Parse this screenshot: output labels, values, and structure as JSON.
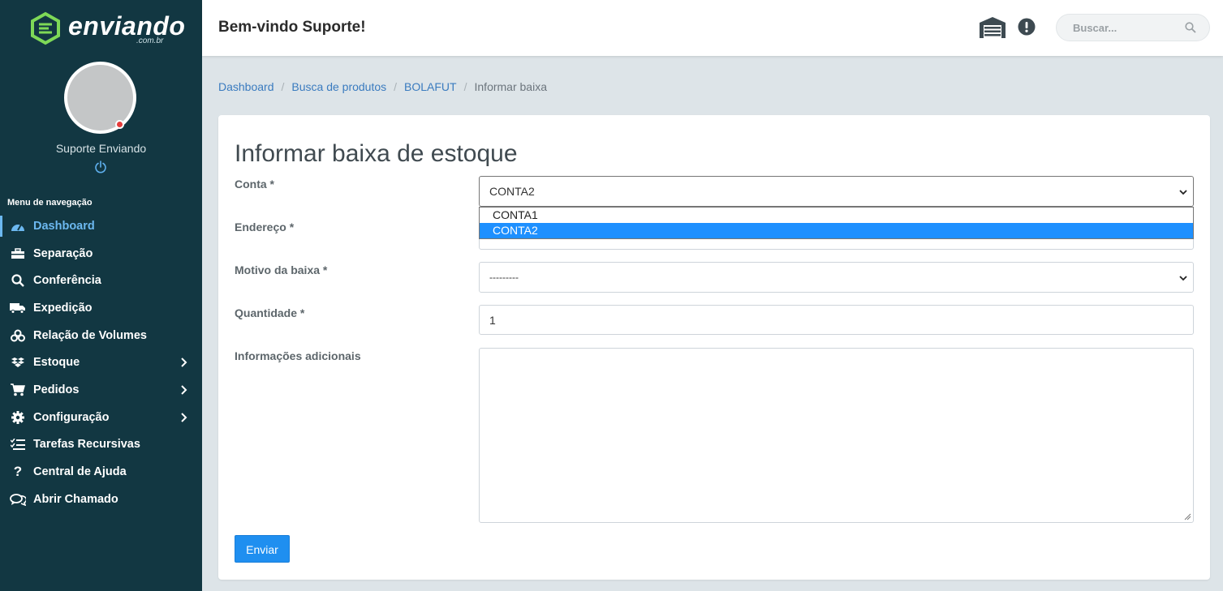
{
  "brand": {
    "name": "enviando",
    "domain": ".com.br"
  },
  "user": {
    "name": "Suporte Enviando"
  },
  "nav": {
    "title": "Menu de navegação",
    "items": [
      {
        "label": "Dashboard",
        "icon": "gauge-icon"
      },
      {
        "label": "Separação",
        "icon": "toolbox-icon"
      },
      {
        "label": "Conferência",
        "icon": "search-icon"
      },
      {
        "label": "Expedição",
        "icon": "truck-icon"
      },
      {
        "label": "Relação de Volumes",
        "icon": "boxes-icon"
      },
      {
        "label": "Estoque",
        "icon": "dropbox-icon"
      },
      {
        "label": "Pedidos",
        "icon": "cart-icon"
      },
      {
        "label": "Configuração",
        "icon": "gear-icon"
      },
      {
        "label": "Tarefas Recursivas",
        "icon": "tasks-icon"
      },
      {
        "label": "Central de Ajuda",
        "icon": "question-icon"
      },
      {
        "label": "Abrir Chamado",
        "icon": "comments-icon"
      }
    ]
  },
  "header": {
    "welcome": "Bem-vindo Suporte!",
    "search_placeholder": "Buscar..."
  },
  "breadcrumb": {
    "items": [
      "Dashboard",
      "Busca de produtos",
      "BOLAFUT"
    ],
    "current": "Informar baixa"
  },
  "form": {
    "title": "Informar baixa de estoque",
    "conta": {
      "label": "Conta *",
      "value": "CONTA2",
      "options": [
        "CONTA1",
        "CONTA2"
      ],
      "selected": "CONTA2"
    },
    "endereco": {
      "label": "Endereço *"
    },
    "motivo": {
      "label": "Motivo da baixa *",
      "value": "---------"
    },
    "quantidade": {
      "label": "Quantidade *",
      "value": "1"
    },
    "info": {
      "label": "Informações adicionais",
      "value": ""
    },
    "submit": "Enviar"
  },
  "colors": {
    "sidebar": "#123742",
    "active": "#6cb8f0",
    "primary": "#1f8ff0",
    "link": "#3a7bbf"
  }
}
